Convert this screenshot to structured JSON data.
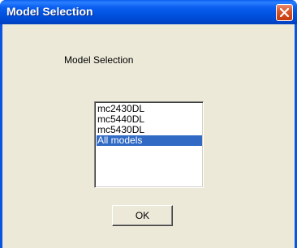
{
  "window": {
    "title": "Model Selection"
  },
  "dialog": {
    "heading": "Model Selection",
    "models": [
      "mc2430DL",
      "mc5440DL",
      "mc5430DL",
      "All models"
    ],
    "selected_model": "All models",
    "ok_label": "OK"
  },
  "icons": {
    "close": "close-icon"
  },
  "colors": {
    "titlebar": "#0054e3",
    "dialog_background": "#ece9d8",
    "selection": "#316ac5",
    "close_button": "#d9572b"
  }
}
